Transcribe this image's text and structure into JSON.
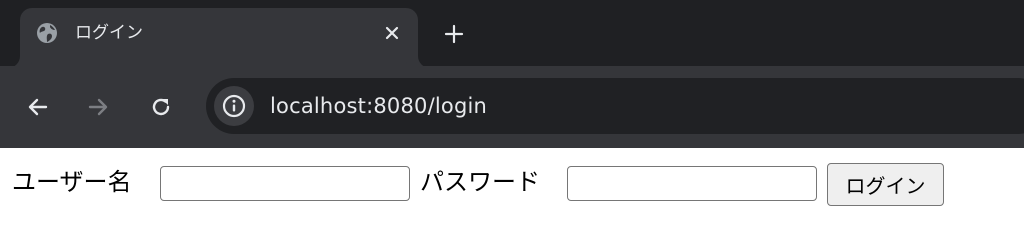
{
  "browser": {
    "tab": {
      "title": "ログイン",
      "favicon": "globe-icon",
      "close_icon": "close-icon"
    },
    "new_tab_icon": "plus-icon",
    "nav": {
      "back_icon": "arrow-left-icon",
      "forward_icon": "arrow-right-icon",
      "forward_enabled": false,
      "reload_icon": "reload-icon"
    },
    "omnibox": {
      "site_info_icon": "info-icon",
      "url": "localhost:8080/login"
    },
    "colors": {
      "tabstrip_bg": "#1f2023",
      "toolbar_bg": "#35363a",
      "omnibox_bg": "#202124",
      "text": "#e8eaed"
    }
  },
  "login_form": {
    "username_label": "ユーザー名",
    "username_value": "",
    "password_label": "パスワード",
    "password_value": "",
    "submit_label": "ログイン"
  }
}
